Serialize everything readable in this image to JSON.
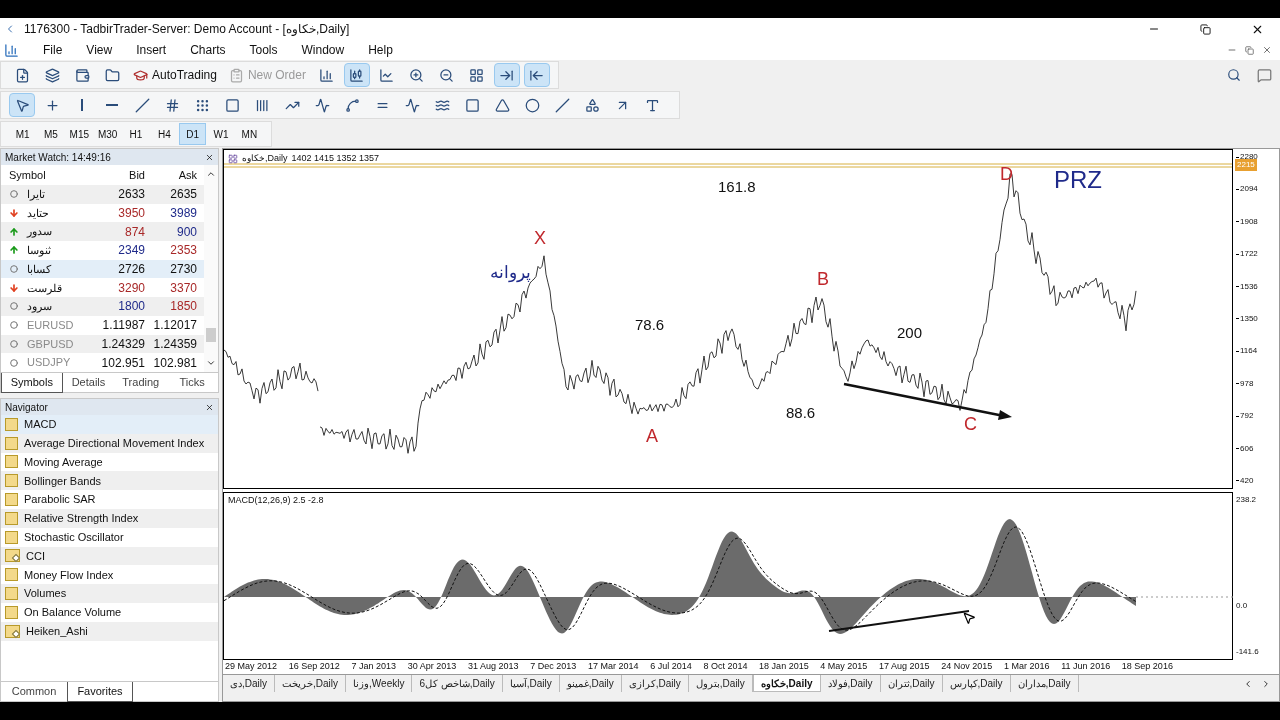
{
  "window": {
    "title": "1176300 - TadbirTrader-Server: Demo Account - [خکاوه,Daily]"
  },
  "menu": [
    "File",
    "View",
    "Insert",
    "Charts",
    "Tools",
    "Window",
    "Help"
  ],
  "toolbar": [
    {
      "kind": "icon",
      "selected": false
    },
    {
      "kind": "icon",
      "selected": false
    },
    {
      "kind": "icon",
      "selected": false
    },
    {
      "kind": "icon",
      "selected": false
    },
    {
      "kind": "text",
      "label": "AutoTrading",
      "disabled": false
    },
    {
      "kind": "text",
      "label": "New Order",
      "disabled": true
    },
    {
      "kind": "icon",
      "selected": false
    },
    {
      "kind": "icon",
      "selected": true
    },
    {
      "kind": "icon",
      "selected": false
    },
    {
      "kind": "icon",
      "selected": false
    },
    {
      "kind": "icon",
      "selected": false
    },
    {
      "kind": "icon",
      "selected": false
    },
    {
      "kind": "icon",
      "selected": true
    },
    {
      "kind": "icon",
      "selected": true
    }
  ],
  "drawing_tools": [
    {
      "selected": true
    },
    {
      "selected": false
    },
    {
      "selected": false
    },
    {
      "selected": false
    },
    {
      "selected": false
    },
    {
      "selected": false
    },
    {
      "selected": false
    },
    {
      "selected": false
    },
    {
      "selected": false
    },
    {
      "selected": false
    },
    {
      "selected": false
    },
    {
      "selected": false
    },
    {
      "selected": false
    },
    {
      "selected": false
    },
    {
      "selected": false
    },
    {
      "selected": false
    },
    {
      "selected": false
    },
    {
      "selected": false
    },
    {
      "selected": false
    },
    {
      "selected": false
    },
    {
      "selected": false
    },
    {
      "selected": false
    }
  ],
  "timeframes": [
    {
      "label": "M1",
      "selected": false
    },
    {
      "label": "M5",
      "selected": false
    },
    {
      "label": "M15",
      "selected": false
    },
    {
      "label": "M30",
      "selected": false
    },
    {
      "label": "H1",
      "selected": false
    },
    {
      "label": "H4",
      "selected": false
    },
    {
      "label": "D1",
      "selected": true
    },
    {
      "label": "W1",
      "selected": false
    },
    {
      "label": "MN",
      "selected": false
    }
  ],
  "market_watch": {
    "title": "Market Watch: 14:49:16",
    "columns": [
      "Symbol",
      "Bid",
      "Ask"
    ],
    "rows": [
      {
        "symbol": "تایرا",
        "kind": "flat",
        "selected": false,
        "dimmed": false,
        "bid": {
          "text": "2633",
          "color": "#111111"
        },
        "ask": {
          "text": "2635",
          "color": "#111111"
        }
      },
      {
        "symbol": "حتاید",
        "kind": "down",
        "selected": false,
        "dimmed": false,
        "bid": {
          "text": "3950",
          "color": "#a82828"
        },
        "ask": {
          "text": "3989",
          "color": "#1f2a8a"
        }
      },
      {
        "symbol": "سدور",
        "kind": "up",
        "selected": false,
        "dimmed": false,
        "bid": {
          "text": "874",
          "color": "#a82828"
        },
        "ask": {
          "text": "900",
          "color": "#1f2a8a"
        }
      },
      {
        "symbol": "ثنوسا",
        "kind": "up",
        "selected": false,
        "dimmed": false,
        "bid": {
          "text": "2349",
          "color": "#1f2a8a"
        },
        "ask": {
          "text": "2353",
          "color": "#a82828"
        }
      },
      {
        "symbol": "کسابا",
        "kind": "flat",
        "selected": true,
        "dimmed": false,
        "bid": {
          "text": "2726",
          "color": "#111111"
        },
        "ask": {
          "text": "2730",
          "color": "#111111"
        }
      },
      {
        "symbol": "قلرست",
        "kind": "down",
        "selected": false,
        "dimmed": false,
        "bid": {
          "text": "3290",
          "color": "#a82828"
        },
        "ask": {
          "text": "3370",
          "color": "#a82828"
        }
      },
      {
        "symbol": "سرود",
        "kind": "flat",
        "selected": false,
        "dimmed": false,
        "bid": {
          "text": "1800",
          "color": "#1f2a8a"
        },
        "ask": {
          "text": "1850",
          "color": "#a82828"
        }
      },
      {
        "symbol": "EURUSD",
        "kind": "flat",
        "selected": false,
        "dimmed": true,
        "bid": {
          "text": "1.11987",
          "color": "#111111"
        },
        "ask": {
          "text": "1.12017",
          "color": "#111111"
        }
      },
      {
        "symbol": "GBPUSD",
        "kind": "flat",
        "selected": false,
        "dimmed": true,
        "bid": {
          "text": "1.24329",
          "color": "#111111"
        },
        "ask": {
          "text": "1.24359",
          "color": "#111111"
        }
      },
      {
        "symbol": "USDJPY",
        "kind": "flat",
        "selected": false,
        "dimmed": true,
        "bid": {
          "text": "102.951",
          "color": "#111111"
        },
        "ask": {
          "text": "102.981",
          "color": "#111111"
        }
      }
    ],
    "tabs": [
      {
        "label": "Symbols",
        "selected": true
      },
      {
        "label": "Details",
        "selected": false
      },
      {
        "label": "Trading",
        "selected": false
      },
      {
        "label": "Ticks",
        "selected": false
      }
    ]
  },
  "navigator": {
    "title": "Navigator",
    "items": [
      {
        "label": "MACD",
        "kind": "indicator",
        "selected": true
      },
      {
        "label": "Average Directional Movement Index",
        "kind": "indicator",
        "selected": false
      },
      {
        "label": "Moving Average",
        "kind": "indicator",
        "selected": false
      },
      {
        "label": "Bollinger Bands",
        "kind": "indicator",
        "selected": false
      },
      {
        "label": "Parabolic SAR",
        "kind": "indicator",
        "selected": false
      },
      {
        "label": "Relative Strength Index",
        "kind": "indicator",
        "selected": false
      },
      {
        "label": "Stochastic Oscillator",
        "kind": "indicator",
        "selected": false
      },
      {
        "label": "CCI",
        "kind": "custom",
        "selected": false
      },
      {
        "label": "Money Flow Index",
        "kind": "indicator",
        "selected": false
      },
      {
        "label": "Volumes",
        "kind": "indicator",
        "selected": false
      },
      {
        "label": "On Balance Volume",
        "kind": "indicator",
        "selected": false
      },
      {
        "label": "Heiken_Ashi",
        "kind": "custom",
        "selected": false
      }
    ],
    "tabs": [
      {
        "label": "Common",
        "selected": false
      },
      {
        "label": "Favorites",
        "selected": true
      }
    ]
  },
  "chart": {
    "symbol": "خکاوه,Daily",
    "ohlc": "1402 1415 1352 1357",
    "price_axis": [
      "2280",
      "2094",
      "1908",
      "1722",
      "1536",
      "1350",
      "1164",
      "978",
      "792",
      "606",
      "420"
    ],
    "current_price": "2215",
    "annotations": [
      {
        "text": "X",
        "color": "#c0282d"
      },
      {
        "text": "A",
        "color": "#c0282d"
      },
      {
        "text": "B",
        "color": "#c0282d"
      },
      {
        "text": "C",
        "color": "#c0282d"
      },
      {
        "text": "D",
        "color": "#c0282d"
      },
      {
        "text": "PRZ",
        "color": "#1f2a8a"
      },
      {
        "text": "پروانه",
        "color": "#1f2a8a"
      },
      {
        "text": "161.8",
        "color": "#111111"
      },
      {
        "text": "78.6",
        "color": "#111111"
      },
      {
        "text": "88.6",
        "color": "#111111"
      },
      {
        "text": "200",
        "color": "#111111"
      }
    ],
    "indicator": {
      "label": "MACD(12,26,9) 2.5 -2.8",
      "axis": [
        "238.2",
        "0.0",
        "-141.6"
      ]
    },
    "dates": [
      "29 May 2012",
      "16 Sep 2012",
      "7 Jan 2013",
      "30 Apr 2013",
      "31 Aug 2013",
      "7 Dec 2013",
      "17 Mar 2014",
      "6 Jul 2014",
      "8 Oct 2014",
      "18 Jan 2015",
      "4 May 2015",
      "17 Aug 2015",
      "24 Nov 2015",
      "1 Mar 2016",
      "11 Jun 2016",
      "18 Sep 2016"
    ]
  },
  "chart_tabs": [
    {
      "label": "دی,Daily",
      "selected": false
    },
    {
      "label": "خریخت,Daily",
      "selected": false
    },
    {
      "label": "وزنا,Weekly",
      "selected": false
    },
    {
      "label": "شاخص کل6,Daily",
      "selected": false
    },
    {
      "label": "آسیا,Daily",
      "selected": false
    },
    {
      "label": "غمینو,Daily",
      "selected": false
    },
    {
      "label": "کرازی,Daily",
      "selected": false
    },
    {
      "label": "بترول,Daily",
      "selected": false
    },
    {
      "label": "خکاوه,Daily",
      "selected": true
    },
    {
      "label": "فولاد,Daily",
      "selected": false
    },
    {
      "label": "ثتران,Daily",
      "selected": false
    },
    {
      "label": "کپارس,Daily",
      "selected": false
    },
    {
      "label": "مداران,Daily",
      "selected": false
    }
  ]
}
